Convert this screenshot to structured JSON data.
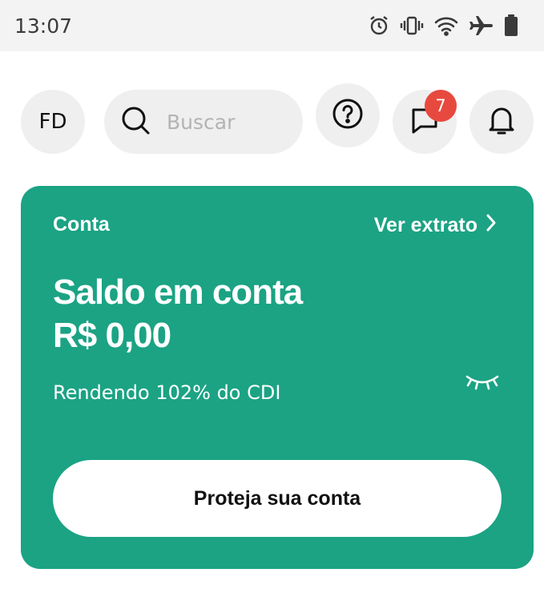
{
  "status_bar": {
    "time": "13:07",
    "icons": [
      "alarm-icon",
      "vibrate-icon",
      "wifi-icon",
      "airplane-icon",
      "battery-icon"
    ]
  },
  "header": {
    "avatar_initials": "FD",
    "search_placeholder": "Buscar",
    "messages_badge": "7",
    "icons": [
      "search-icon",
      "help-icon",
      "chat-icon",
      "bell-icon"
    ]
  },
  "account_card": {
    "label": "Conta",
    "statement_link": "Ver extrato",
    "balance_title": "Saldo em conta",
    "balance_value": "R$ 0,00",
    "yield_text": "Rendendo 102% do CDI",
    "protect_button": "Proteja sua conta"
  },
  "colors": {
    "card_background": "#1ba384",
    "badge": "#e8493f",
    "chip_background": "#efefef"
  }
}
